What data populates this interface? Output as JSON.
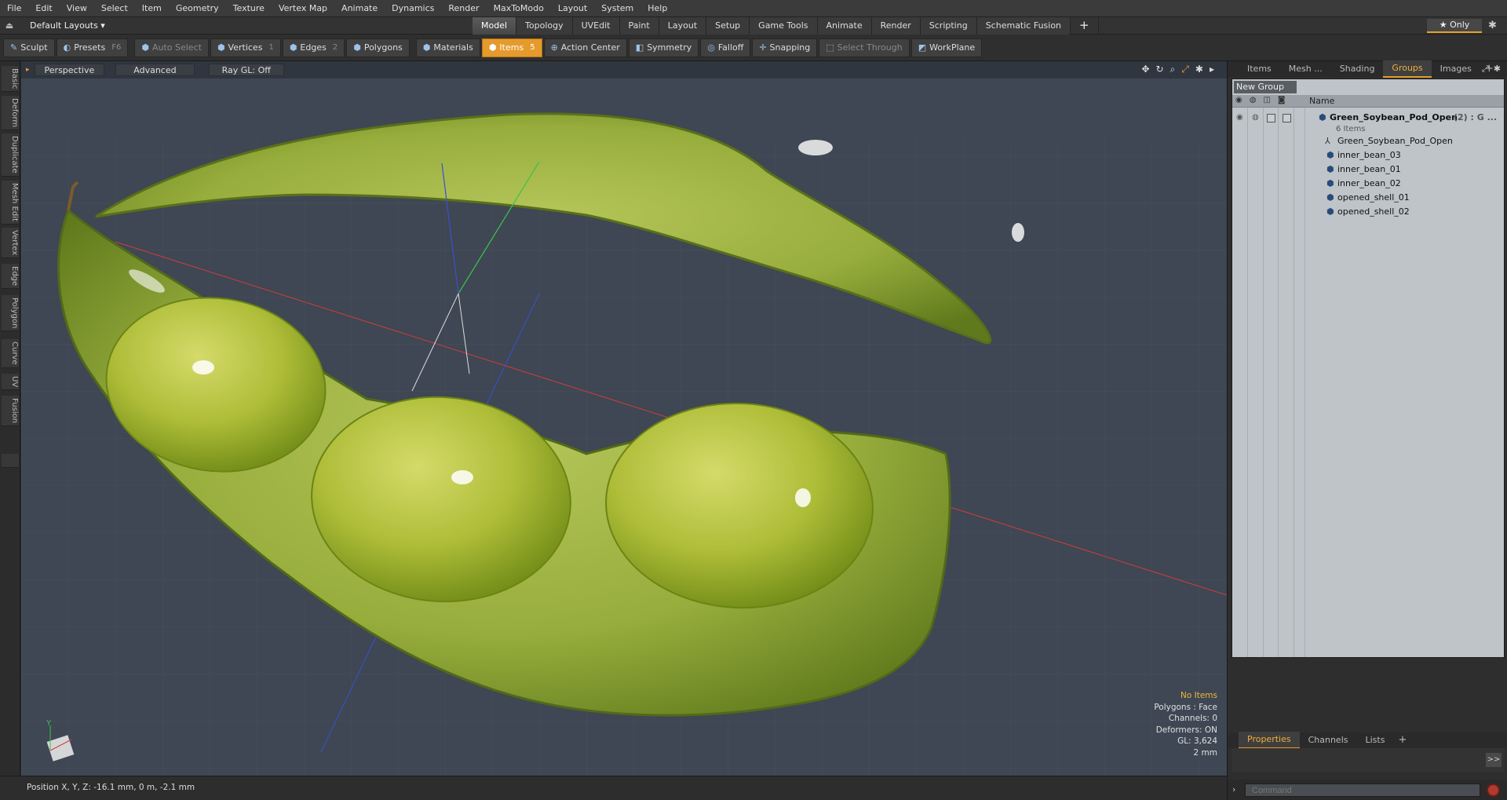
{
  "menu": [
    "File",
    "Edit",
    "View",
    "Select",
    "Item",
    "Geometry",
    "Texture",
    "Vertex Map",
    "Animate",
    "Dynamics",
    "Render",
    "MaxToModo",
    "Layout",
    "System",
    "Help"
  ],
  "layout_select": "Default Layouts ▾",
  "mode_tabs": [
    "Model",
    "Topology",
    "UVEdit",
    "Paint",
    "Layout",
    "Setup",
    "Game Tools",
    "Animate",
    "Render",
    "Scripting",
    "Schematic Fusion"
  ],
  "mode_tab_plus": "+",
  "only_button": "★  Only",
  "toolbar": {
    "sculpt": "Sculpt",
    "presets": "Presets",
    "presets_key": "F6",
    "auto_select": "Auto Select",
    "vertices": "Vertices",
    "vertices_key": "1",
    "edges": "Edges",
    "edges_key": "2",
    "polygons": "Polygons",
    "materials": "Materials",
    "items": "Items",
    "items_key": "5",
    "action_center": "Action Center",
    "symmetry": "Symmetry",
    "falloff": "Falloff",
    "snapping": "Snapping",
    "select_through": "Select Through",
    "workplane": "WorkPlane"
  },
  "side_tabs": [
    "Basic",
    "Deform",
    "Duplicate",
    "Mesh Edit",
    "Vertex",
    "Edge",
    "Polygon",
    "Curve",
    "UV",
    "Fusion"
  ],
  "viewport": {
    "view_label": "Perspective",
    "shading_label": "Advanced",
    "raygl_label": "Ray GL: Off",
    "info": {
      "selection": "No Items",
      "polygons": "Polygons : Face",
      "channels": "Channels: 0",
      "deformers": "Deformers: ON",
      "gl": "GL: 3,624",
      "scale": "2 mm"
    },
    "axis_y": "Y"
  },
  "status": {
    "position": "Position X, Y, Z:  -16.1 mm, 0 m, -2.1 mm"
  },
  "right_panel": {
    "tabs": [
      "Items",
      "Mesh ...",
      "Shading",
      "Groups",
      "Images"
    ],
    "active_tab": "Groups",
    "tab_plus": "+",
    "new_group": "New Group",
    "column_name": "Name",
    "root": {
      "label": "Green_Soybean_Pod_Open",
      "suffix": "(2) : G ...",
      "count": "6 Items"
    },
    "children": [
      "Green_Soybean_Pod_Open",
      "inner_bean_03",
      "inner_bean_01",
      "inner_bean_02",
      "opened_shell_01",
      "opened_shell_02"
    ],
    "bottom_tabs": [
      "Properties",
      "Channels",
      "Lists"
    ],
    "bottom_plus": "+",
    "expand_button": ">>",
    "command_placeholder": "Command"
  },
  "colors": {
    "accent": "#e59a2c",
    "viewport_bg": "#3e4753",
    "axis_x": "#d23c3c",
    "axis_y": "#3cc24a",
    "axis_z": "#3c4fd2"
  }
}
